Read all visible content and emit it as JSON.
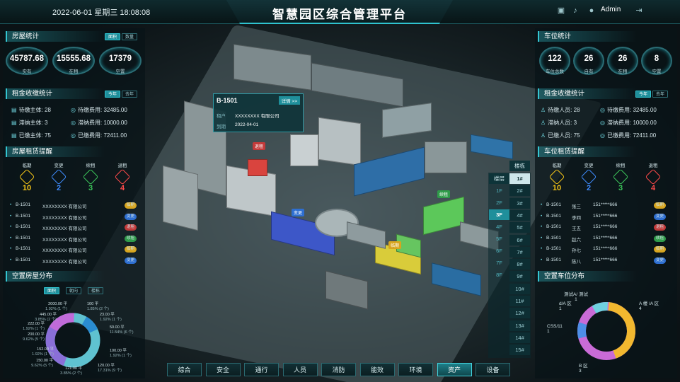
{
  "header": {
    "title": "智慧园区综合管理平台",
    "datetime": "2022-06-01 星期三 18:08:08",
    "user": "Admin",
    "icons": [
      "screen-icon",
      "bell-icon",
      "user-icon",
      "logout-icon"
    ]
  },
  "house_stats": {
    "title": "房屋统计",
    "tabs": [
      "面积",
      "数量"
    ],
    "items": [
      {
        "value": "45787.68",
        "label": "实有"
      },
      {
        "value": "15555.68",
        "label": "在租"
      },
      {
        "value": "17379",
        "label": "空置"
      }
    ]
  },
  "rent_left": {
    "title": "租金收缴统计",
    "tabs": [
      "今年",
      "去年"
    ],
    "rows": [
      {
        "a_label": "待缴主体:",
        "a_val": "28",
        "b_label": "待缴费用:",
        "b_val": "32485.00"
      },
      {
        "a_label": "滞纳主体:",
        "a_val": "3",
        "b_label": "滞纳费用:",
        "b_val": "10000.00"
      },
      {
        "a_label": "已缴主体:",
        "a_val": "75",
        "b_label": "已缴费用:",
        "b_val": "72411.00"
      }
    ]
  },
  "house_remind": {
    "title": "房屋租赁提醒",
    "types": [
      {
        "label": "临期",
        "count": "10",
        "color": "#f5c518"
      },
      {
        "label": "变更",
        "count": "2",
        "color": "#3f8cff"
      },
      {
        "label": "续租",
        "count": "3",
        "color": "#3cc65a"
      },
      {
        "label": "退租",
        "count": "4",
        "color": "#ff4a4a"
      }
    ],
    "rows": [
      {
        "room": "B-1501",
        "company": "XXXXXXXX 有限公司",
        "status": "临期",
        "color": "#d7a51e"
      },
      {
        "room": "B-1501",
        "company": "XXXXXXXX 有限公司",
        "status": "变更",
        "color": "#2e6fd1"
      },
      {
        "room": "B-1501",
        "company": "XXXXXXXX 有限公司",
        "status": "退租",
        "color": "#c33a3a"
      },
      {
        "room": "B-1501",
        "company": "XXXXXXXX 有限公司",
        "status": "续租",
        "color": "#2f9b49"
      },
      {
        "room": "B-1501",
        "company": "XXXXXXXX 有限公司",
        "status": "临期",
        "color": "#d7a51e"
      },
      {
        "room": "B-1501",
        "company": "XXXXXXXX 有限公司",
        "status": "变更",
        "color": "#2e6fd1"
      }
    ]
  },
  "vacant_house": {
    "title": "空置房屋分布",
    "tabs": [
      "面积",
      "朝向",
      "楼栋"
    ],
    "labels": [
      {
        "l1": "100 平",
        "l2": "1.85% (2 个)"
      },
      {
        "l1": "23.00 平",
        "l2": "1.92% (1 个)"
      },
      {
        "l1": "50.00 平",
        "l2": "11.54% (6 个)"
      },
      {
        "l1": "100.00 平",
        "l2": "1.92% (1 个)"
      },
      {
        "l1": "120.00 平",
        "l2": "17.31% (9 个)"
      },
      {
        "l1": "121.00 平",
        "l2": "3.85% (2 个)"
      },
      {
        "l1": "150.00 平",
        "l2": "9.62% (5 个)"
      },
      {
        "l1": "152.00 平",
        "l2": "1.92% (1 个)"
      },
      {
        "l1": "200.00 平",
        "l2": "9.62% (5 个)"
      },
      {
        "l1": "222.00 平",
        "l2": "1.92% (1 个)"
      },
      {
        "l1": "445.00 平",
        "l2": "3.85% (2 个)"
      },
      {
        "l1": "2000.00 平",
        "l2": "1.92% (1 个)"
      }
    ]
  },
  "parking": {
    "title": "车位统计",
    "items": [
      {
        "value": "122",
        "label": "车位总数"
      },
      {
        "value": "26",
        "label": "自有"
      },
      {
        "value": "26",
        "label": "在租"
      },
      {
        "value": "8",
        "label": "空置"
      }
    ]
  },
  "rent_right": {
    "title": "租金收缴统计",
    "tabs": [
      "今年",
      "去年"
    ],
    "rows": [
      {
        "a_label": "待缴人员:",
        "a_val": "28",
        "b_label": "待缴费用:",
        "b_val": "32485.00"
      },
      {
        "a_label": "滞纳人员:",
        "a_val": "3",
        "b_label": "滞纳费用:",
        "b_val": "10000.00"
      },
      {
        "a_label": "已缴人员:",
        "a_val": "75",
        "b_label": "已缴费用:",
        "b_val": "72411.00"
      }
    ]
  },
  "parking_remind": {
    "title": "车位租赁提醒",
    "types": [
      {
        "label": "临期",
        "count": "10",
        "color": "#f5c518"
      },
      {
        "label": "变更",
        "count": "2",
        "color": "#3f8cff"
      },
      {
        "label": "续租",
        "count": "3",
        "color": "#3cc65a"
      },
      {
        "label": "退租",
        "count": "4",
        "color": "#ff4a4a"
      }
    ],
    "rows": [
      {
        "room": "B-1501",
        "name": "张三",
        "phone": "151*****666",
        "status": "临期",
        "color": "#d7a51e"
      },
      {
        "room": "B-1501",
        "name": "李四",
        "phone": "151*****666",
        "status": "变更",
        "color": "#2e6fd1"
      },
      {
        "room": "B-1501",
        "name": "王五",
        "phone": "151*****666",
        "status": "退租",
        "color": "#c33a3a"
      },
      {
        "room": "B-1501",
        "name": "赵六",
        "phone": "151*****666",
        "status": "续租",
        "color": "#2f9b49"
      },
      {
        "room": "B-1501",
        "name": "孙七",
        "phone": "151*****666",
        "status": "临期",
        "color": "#d7a51e"
      },
      {
        "room": "B-1501",
        "name": "陈八",
        "phone": "151*****666",
        "status": "变更",
        "color": "#2e6fd1"
      }
    ]
  },
  "vacant_parking": {
    "title": "空置车位分布",
    "labels": [
      {
        "l1": "测试A/ 测试",
        "l2": "1"
      },
      {
        "l1": "A 楼 /A 区",
        "l2": "4"
      },
      {
        "l1": "d/A 区",
        "l2": "1"
      },
      {
        "l1": "CSS/11",
        "l2": "1"
      },
      {
        "l1": "B 区",
        "l2": "3"
      }
    ]
  },
  "popup": {
    "room": "B-1501",
    "detail": "详情 >>",
    "tenant_label": "租户",
    "tenant": "XXXXXXXX 有限公司",
    "expire_label": "到期",
    "expire": "2022-04-01"
  },
  "map_tags": [
    {
      "text": "退租",
      "color": "#c33a3a"
    },
    {
      "text": "变更",
      "color": "#2e6fd1"
    },
    {
      "text": "续租",
      "color": "#2f9b49"
    },
    {
      "text": "临期",
      "color": "#d7a51e"
    }
  ],
  "floors": {
    "header": "楼栋",
    "selected_floor": "3F",
    "selected_bldg": "1#",
    "floor_list": [
      "楼层",
      "1F",
      "2F",
      "3F",
      "4F",
      "5F",
      "6F",
      "7F",
      "8F"
    ],
    "bldg_list": [
      "1#",
      "2#",
      "3#",
      "4#",
      "5#",
      "6#",
      "7#",
      "8#",
      "9#",
      "10#",
      "11#",
      "12#",
      "13#",
      "14#",
      "15#"
    ]
  },
  "nav": [
    "综合",
    "安全",
    "通行",
    "人员",
    "消防",
    "能效",
    "环境",
    "资产",
    "设备"
  ],
  "nav_active": "资产"
}
